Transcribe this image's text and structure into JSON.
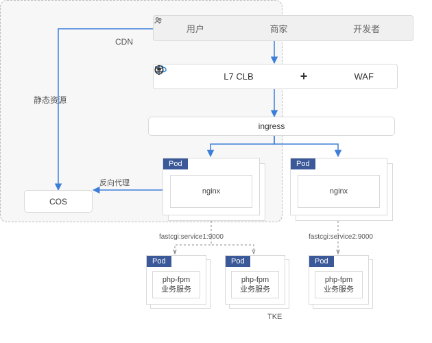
{
  "topbar": {
    "user": "用户",
    "merchant": "商家",
    "developer": "开发者"
  },
  "midrow": {
    "clb": "L7 CLB",
    "waf": "WAF"
  },
  "labels": {
    "cdn": "CDN",
    "static_assets": "静态资源",
    "cos": "COS",
    "reverse_proxy": "反向代理",
    "ingress": "ingress",
    "tke": "TKE",
    "fastcgi1": "fastcgi:service1:9000",
    "fastcgi2": "fastcgi:service2:9000"
  },
  "pod": {
    "badge": "Pod"
  },
  "nginx": {
    "title": "nginx"
  },
  "php": {
    "line1": "php-fpm",
    "line2": "业务服务"
  }
}
